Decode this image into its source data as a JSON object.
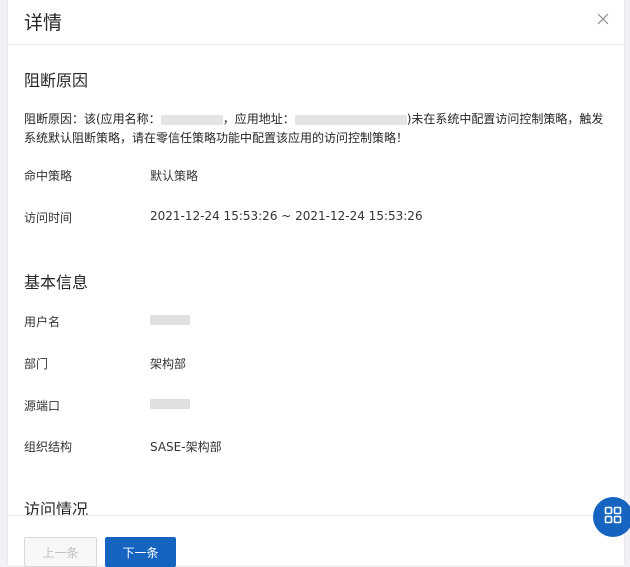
{
  "dialog": {
    "title": "详情"
  },
  "block_reason": {
    "section_title": "阻断原因",
    "text_part1": "阻断原因：该(应用名称：",
    "text_part2": "，应用地址：",
    "text_part3": ")未在系统中配置访问控制策略，触发",
    "text_line2": "系统默认阻断策略，请在零信任策略功能中配置该应用的访问控制策略！",
    "hit_policy_label": "命中策略",
    "hit_policy_value": "默认策略",
    "access_time_label": "访问时间",
    "access_time_value": "2021-12-24 15:53:26 ~ 2021-12-24 15:53:26"
  },
  "basic_info": {
    "section_title": "基本信息",
    "username_label": "用户名",
    "department_label": "部门",
    "department_value": "架构部",
    "source_port_label": "源端口",
    "org_label": "组织结构",
    "org_value": "SASE-架构部"
  },
  "access_situation": {
    "section_title": "访问情况"
  },
  "footer": {
    "prev_label": "上一条",
    "next_label": "下一条"
  },
  "colors": {
    "primary": "#1565c0",
    "disabled_text": "#bfbfbf",
    "border": "#e8e8e8"
  }
}
